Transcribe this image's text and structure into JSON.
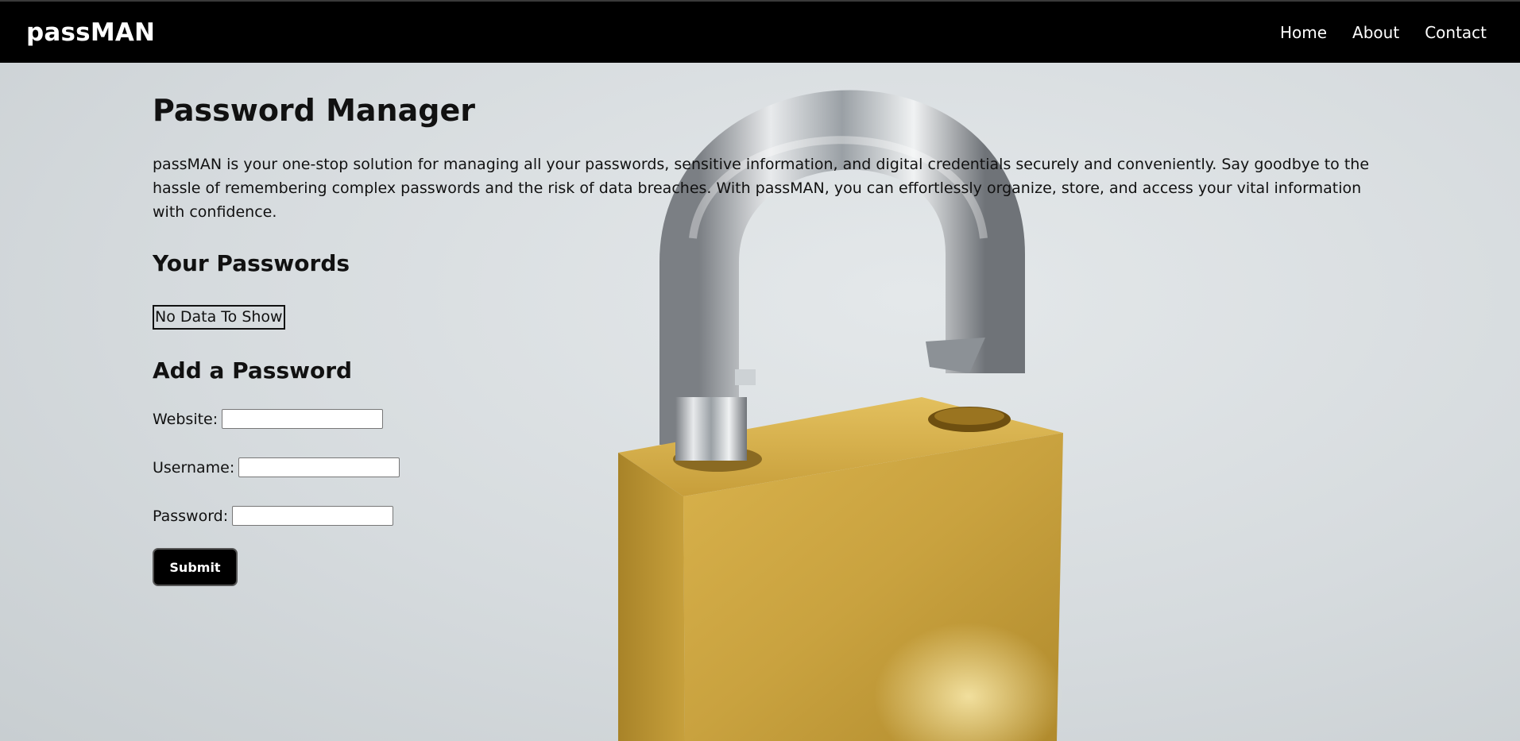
{
  "nav": {
    "brand": "passMAN",
    "links": [
      "Home",
      "About",
      "Contact"
    ]
  },
  "main": {
    "title": "Password Manager",
    "intro": "passMAN is your one-stop solution for managing all your passwords, sensitive information, and digital credentials securely and conveniently. Say goodbye to the hassle of remembering complex passwords and the risk of data breaches. With passMAN, you can effortlessly organize, store, and access your vital information with confidence.",
    "your_passwords_heading": "Your Passwords",
    "no_data_text": "No Data To Show",
    "add_heading": "Add a Password",
    "fields": [
      {
        "label": "Website:",
        "value": ""
      },
      {
        "label": "Username:",
        "value": ""
      },
      {
        "label": "Password:",
        "value": ""
      }
    ],
    "submit_label": "Submit"
  },
  "background": {
    "image": "padlock-icon",
    "colors": {
      "backdrop": "#d8dde0",
      "lock_body": "#c9a23f",
      "shackle": "#b8bcc0",
      "navbar": "#000000"
    }
  }
}
